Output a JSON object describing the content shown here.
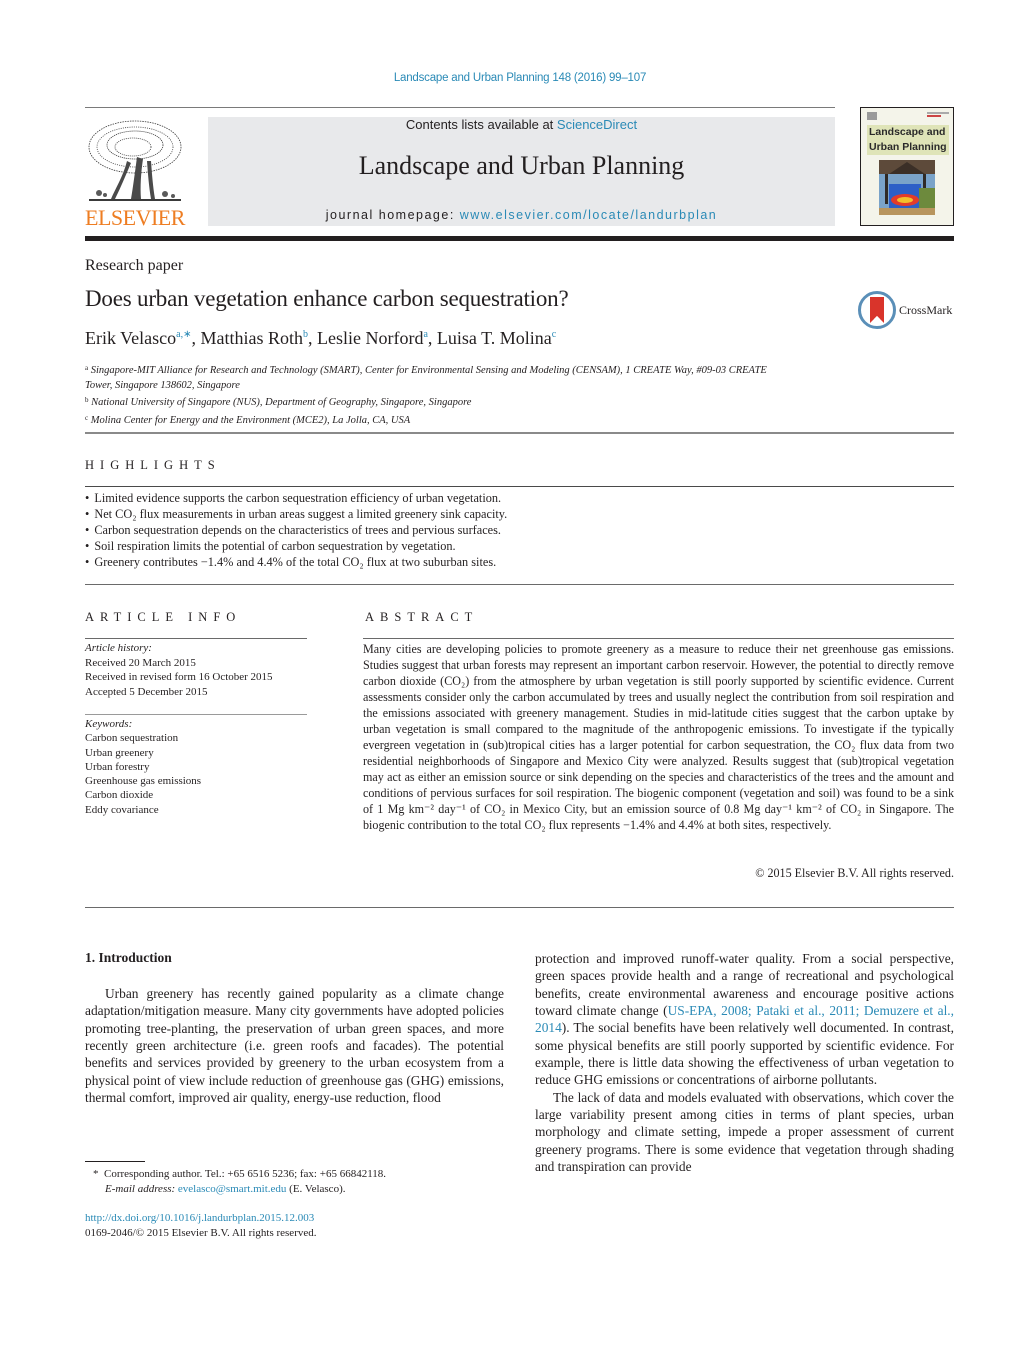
{
  "header": {
    "journal_citation": "Landscape and Urban Planning 148 (2016) 99–107",
    "publisher_logo_text": "ELSEVIER",
    "contents_prefix": "Contents lists available at ",
    "contents_link": "ScienceDirect",
    "journal_name": "Landscape and Urban Planning",
    "homepage_prefix": "journal homepage: ",
    "homepage_link": "www.elsevier.com/locate/landurbplan",
    "cover_title_line1": "Landscape and",
    "cover_title_line2": "Urban Planning"
  },
  "article": {
    "type": "Research paper",
    "title": "Does urban vegetation enhance carbon sequestration?",
    "crossmark_label": "CrossMark",
    "authors": [
      {
        "name": "Erik Velasco",
        "sup": "a,∗",
        "sep": ", "
      },
      {
        "name": "Matthias Roth",
        "sup": "b",
        "sep": ", "
      },
      {
        "name": "Leslie Norford",
        "sup": "a",
        "sep": ", "
      },
      {
        "name": "Luisa T. Molina",
        "sup": "c",
        "sep": ""
      }
    ],
    "affiliations": [
      {
        "mark": "a",
        "text": "Singapore-MIT Alliance for Research and Technology (SMART), Center for Environmental Sensing and Modeling (CENSAM), 1 CREATE Way, #09-03 CREATE Tower, Singapore 138602, Singapore"
      },
      {
        "mark": "b",
        "text": "National University of Singapore (NUS), Department of Geography, Singapore, Singapore"
      },
      {
        "mark": "c",
        "text": "Molina Center for Energy and the Environment (MCE2), La Jolla, CA, USA"
      }
    ]
  },
  "highlights": {
    "heading": "HIGHLIGHTS",
    "items": [
      "Limited evidence supports the carbon sequestration efficiency of urban vegetation.",
      "Net CO₂ flux measurements in urban areas suggest a limited greenery sink capacity.",
      "Carbon sequestration depends on the characteristics of trees and pervious surfaces.",
      "Soil respiration limits the potential of carbon sequestration by vegetation.",
      "Greenery contributes −1.4% and 4.4% of the total CO₂ flux at two suburban sites."
    ]
  },
  "article_info": {
    "heading": "ARTICLE INFO",
    "history_label": "Article history:",
    "history": [
      "Received 20 March 2015",
      "Received in revised form 16 October 2015",
      "Accepted 5 December 2015"
    ],
    "keywords_label": "Keywords:",
    "keywords": [
      "Carbon sequestration",
      "Urban greenery",
      "Urban forestry",
      "Greenhouse gas emissions",
      "Carbon dioxide",
      "Eddy covariance"
    ]
  },
  "abstract": {
    "heading": "ABSTRACT",
    "text": "Many cities are developing policies to promote greenery as a measure to reduce their net greenhouse gas emissions. Studies suggest that urban forests may represent an important carbon reservoir. However, the potential to directly remove carbon dioxide (CO₂) from the atmosphere by urban vegetation is still poorly supported by scientific evidence. Current assessments consider only the carbon accumulated by trees and usually neglect the contribution from soil respiration and the emissions associated with greenery management. Studies in mid-latitude cities suggest that the carbon uptake by urban vegetation is small compared to the magnitude of the anthropogenic emissions. To investigate if the typically evergreen vegetation in (sub)tropical cities has a larger potential for carbon sequestration, the CO₂ flux data from two residential neighborhoods of Singapore and Mexico City were analyzed. Results suggest that (sub)tropical vegetation may act as either an emission source or sink depending on the species and characteristics of the trees and the amount and conditions of pervious surfaces for soil respiration. The biogenic component (vegetation and soil) was found to be a sink of 1 Mg km⁻² day⁻¹ of CO₂ in Mexico City, but an emission source of 0.8 Mg day⁻¹ km⁻² of CO₂ in Singapore. The biogenic contribution to the total CO₂ flux represents −1.4% and 4.4% at both sites, respectively.",
    "copyright": "© 2015 Elsevier B.V. All rights reserved."
  },
  "body": {
    "section_heading": "1.  Introduction",
    "left_paragraph": "Urban greenery has recently gained popularity as a climate change adaptation/mitigation measure. Many city governments have adopted policies promoting tree-planting, the preservation of urban green spaces, and more recently green architecture (i.e. green roofs and facades). The potential benefits and services provided by greenery to the urban ecosystem from a physical point of view include reduction of greenhouse gas (GHG) emissions, thermal comfort, improved air quality, energy-use reduction, flood",
    "right_p1_before": "protection and improved runoff-water quality. From a social perspective, green spaces provide health and a range of recreational and psychological benefits, create environmental awareness and encourage positive actions toward climate change (",
    "right_p1_citations": "US-EPA, 2008; Pataki et al., 2011; Demuzere et al., 2014",
    "right_p1_after": "). The social benefits have been relatively well documented. In contrast, some physical benefits are still poorly supported by scientific evidence. For example, there is little data showing the effectiveness of urban vegetation to reduce GHG emissions or concentrations of airborne pollutants.",
    "right_p2": "The lack of data and models evaluated with observations, which cover the large variability present among cities in terms of plant species, urban morphology and climate setting, impede a proper assessment of current greenery programs. There is some evidence that vegetation through shading and transpiration can provide"
  },
  "footnotes": {
    "corresponding_mark": "*",
    "corresponding": "Corresponding author. Tel.: +65 6516 5236; fax: +65 66842118.",
    "email_label": "E-mail address: ",
    "email": "evelasco@smart.mit.edu",
    "email_suffix": " (E. Velasco).",
    "doi": "http://dx.doi.org/10.1016/j.landurbplan.2015.12.003",
    "issn_copyright": "0169-2046/© 2015 Elsevier B.V. All rights reserved."
  },
  "colors": {
    "link": "#2a8ab6",
    "elsevier_orange": "#ee7d22",
    "banner_bg": "#e8e9eb",
    "crossmark_red": "#d9342b"
  }
}
